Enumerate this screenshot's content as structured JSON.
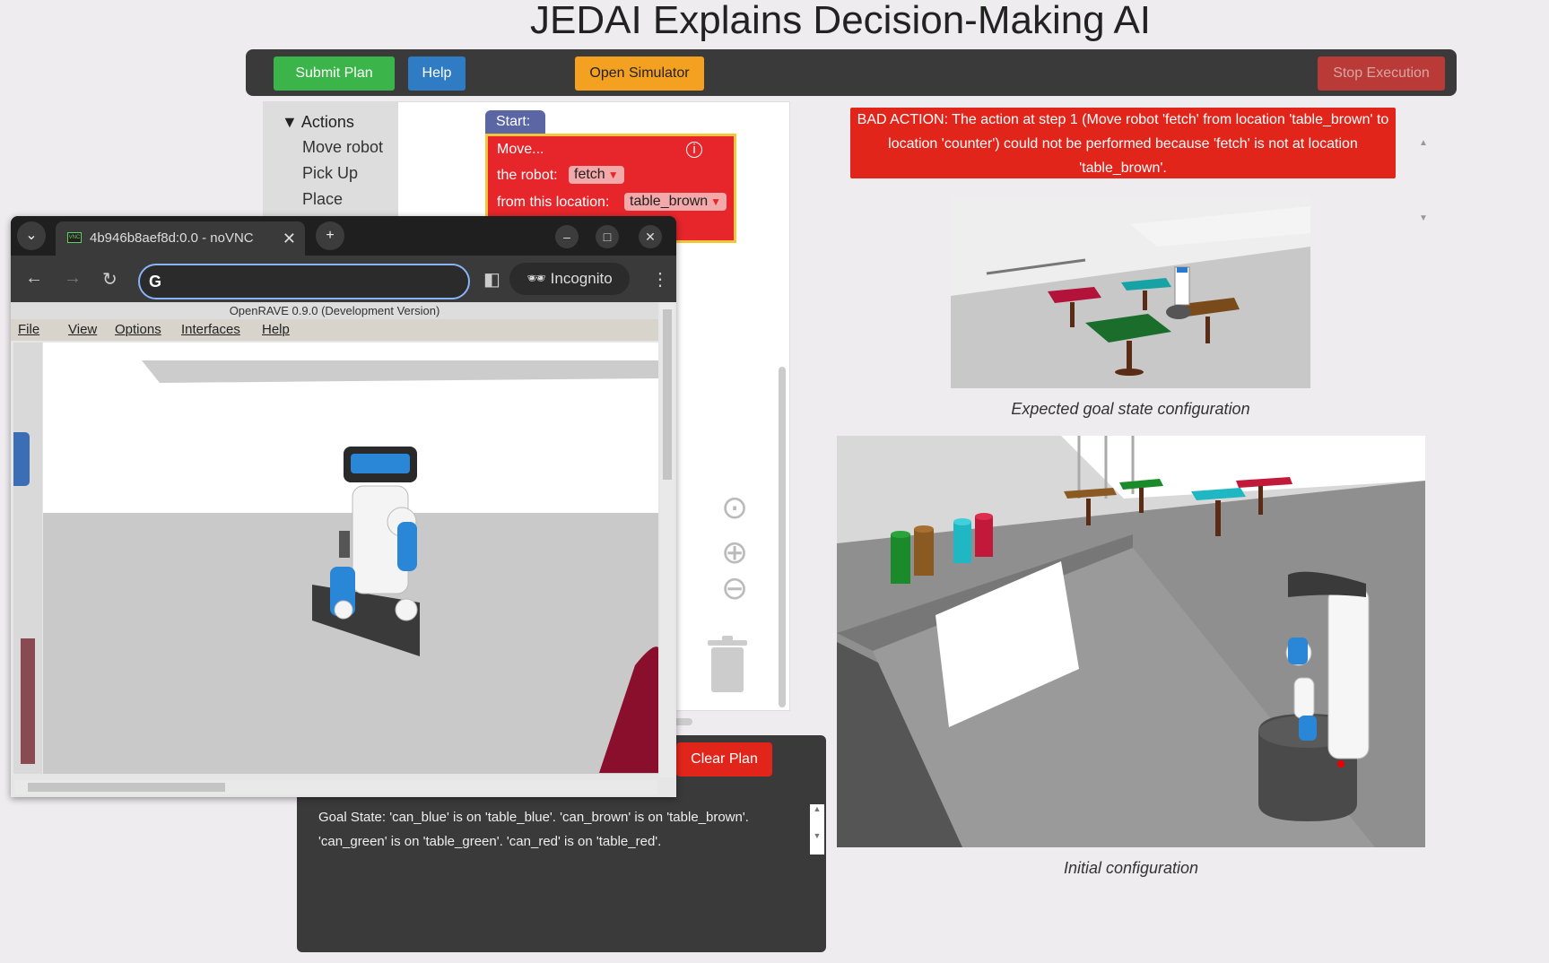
{
  "title": "JEDAI Explains Decision-Making AI",
  "toolbar": {
    "submit_label": "Submit Plan",
    "help_label": "Help",
    "simulator_label": "Open Simulator",
    "stop_label": "Stop Execution"
  },
  "toolbox": {
    "category": "Actions",
    "items": [
      "Move robot",
      "Pick Up",
      "Place"
    ]
  },
  "workspace": {
    "start_label": "Start:",
    "block": {
      "title": "Move...",
      "robot_label": "the robot:",
      "robot_value": "fetch",
      "from_label": "from this location:",
      "from_value": "table_brown"
    }
  },
  "error": {
    "message": "BAD ACTION: The action at step 1 (Move robot 'fetch' from location 'table_brown' to location 'counter') could not be performed because 'fetch' is not at location 'table_brown'."
  },
  "captions": {
    "goal": "Expected goal state configuration",
    "initial": "Initial configuration"
  },
  "plan_panel": {
    "clear_label": "Clear Plan",
    "goal_state": "Goal State: 'can_blue' is on 'table_blue'. 'can_brown' is on 'table_brown'. 'can_green' is on 'table_green'. 'can_red' is on 'table_red'."
  },
  "browser": {
    "tab_title": "4b946b8aef8d:0.0 - noVNC",
    "incognito_label": "Incognito",
    "openrave_title": "OpenRAVE 0.9.0 (Development Version)",
    "menu": [
      "File",
      "View",
      "Options",
      "Interfaces",
      "Help"
    ]
  },
  "colors": {
    "submit": "#3bb54a",
    "help": "#2f7cc4",
    "simulator": "#f4a020",
    "stop": "#b93a36",
    "error": "#e1251b"
  }
}
